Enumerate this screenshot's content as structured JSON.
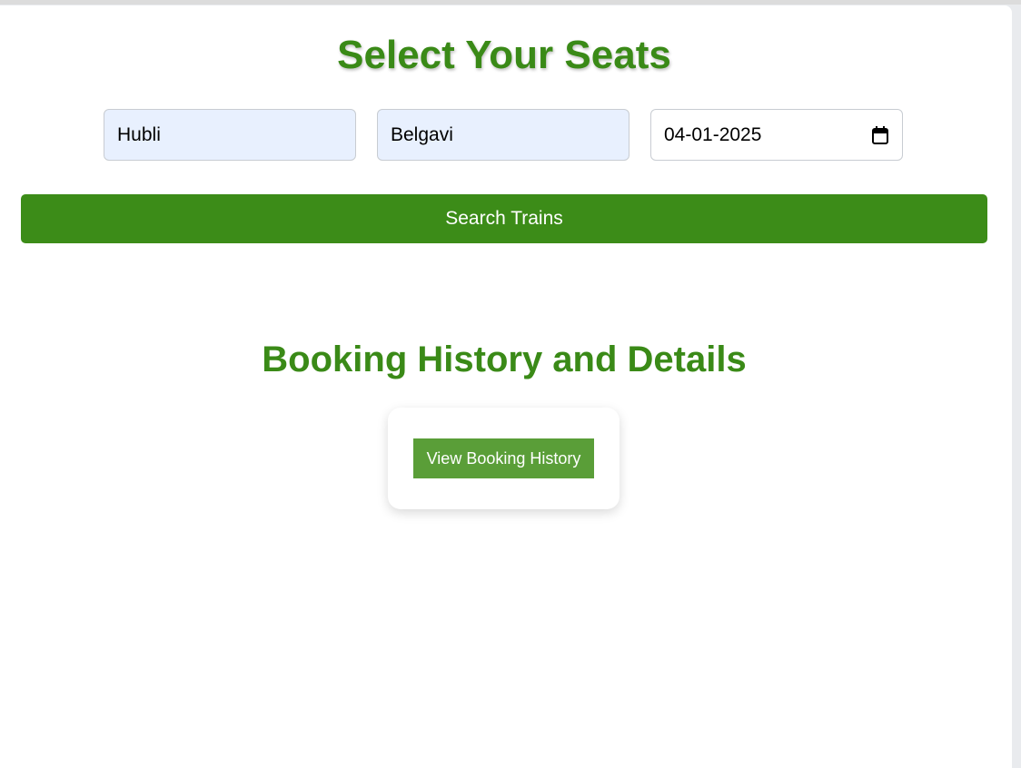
{
  "seat_search": {
    "title": "Select Your Seats",
    "from_value": "Hubli",
    "to_value": "Belgavi",
    "date_value": "04-01-2025",
    "search_label": "Search Trains"
  },
  "booking_history": {
    "title": "Booking History and Details",
    "button_label": "View Booking History"
  },
  "colors": {
    "primary_green": "#3c8c18",
    "button_green": "#5a9e38"
  }
}
